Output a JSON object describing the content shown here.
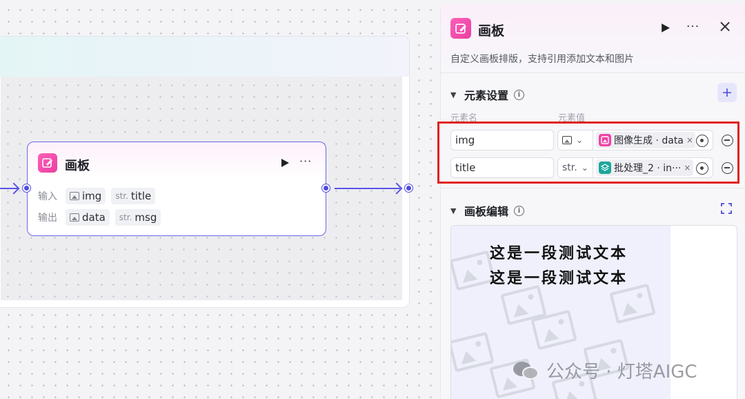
{
  "node": {
    "title": "画板",
    "more": "···",
    "inputs_label": "输入",
    "outputs_label": "输出",
    "inputs": [
      {
        "type": "",
        "name": "img"
      },
      {
        "type": "str.",
        "name": "title"
      }
    ],
    "outputs": [
      {
        "type": "",
        "name": "data"
      },
      {
        "type": "str.",
        "name": "msg"
      }
    ]
  },
  "panel": {
    "title": "画板",
    "more": "···",
    "close": "×",
    "description": "自定义画板排版，支持引用添加文本和图片",
    "element_settings": {
      "title": "元素设置",
      "add": "+",
      "col_name": "元素名",
      "col_value": "元素值",
      "rows": [
        {
          "name": "img",
          "type": "",
          "ref": "图像生成 · data",
          "ref_icon": "image-gen-icon"
        },
        {
          "name": "title",
          "type": "str.",
          "ref": "批处理_2 · in···",
          "ref_icon": "batch-icon"
        }
      ]
    },
    "canvas_edit": {
      "title": "画板编辑",
      "lines": [
        "这是一段测试文本",
        "这是一段测试文本"
      ]
    }
  },
  "watermark": "公众号 · 灯塔AIGC",
  "colors": {
    "accent": "#5753e6",
    "brand_pink": "#f043a7",
    "teal": "#1ca79b",
    "highlight_red": "#e0221f"
  }
}
